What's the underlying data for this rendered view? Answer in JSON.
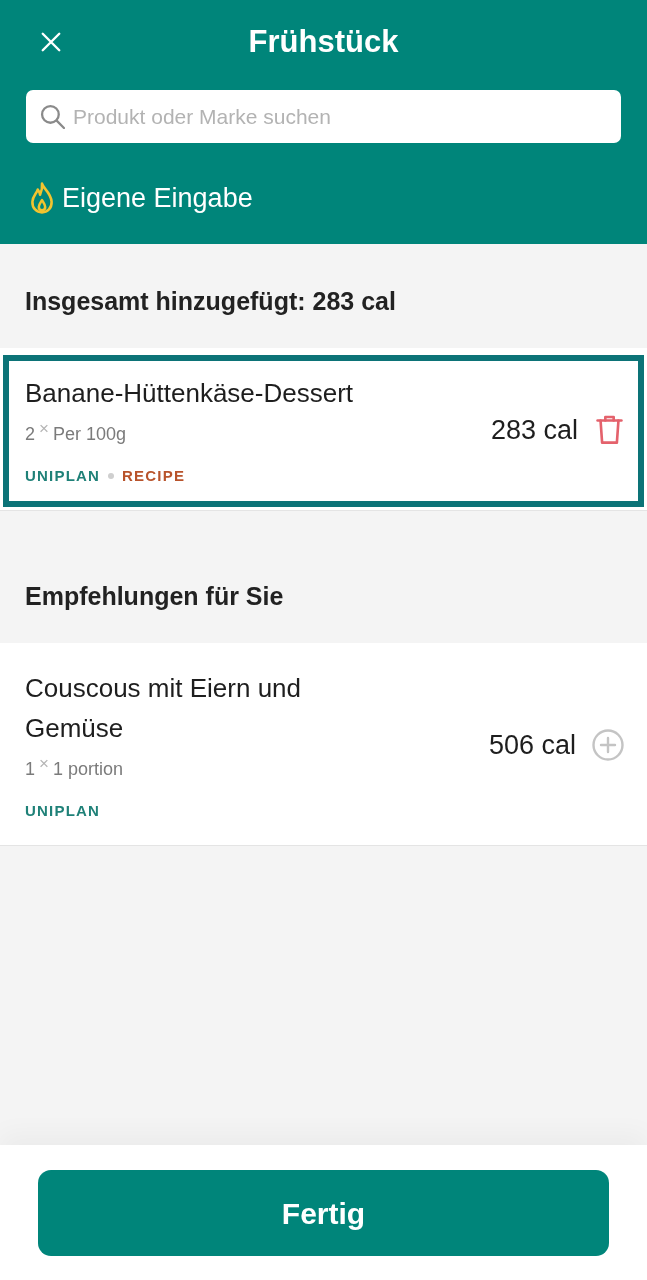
{
  "header": {
    "title": "Frühstück"
  },
  "search": {
    "placeholder": "Produkt oder Marke suchen"
  },
  "custom_entry": {
    "label": "Eigene Eingabe"
  },
  "added": {
    "heading": "Insgesamt hinzugefügt: 283 cal",
    "items": [
      {
        "name": "Banane-Hüttenkäse-Dessert",
        "quantity": "2",
        "times": "×",
        "unit": "Per 100g",
        "tags": [
          {
            "label": "UNIPLAN",
            "color": "#1f8178"
          },
          {
            "label": "RECIPE",
            "color": "#b8532b"
          }
        ],
        "calories": "283 cal",
        "kind": "delete",
        "selected": true
      }
    ]
  },
  "recommendations": {
    "heading": "Empfehlungen für Sie",
    "items": [
      {
        "name": "Couscous mit Eiern und Gemüse",
        "quantity": "1",
        "times": "×",
        "unit": "1 portion",
        "tags": [
          {
            "label": "UNIPLAN",
            "color": "#1f8178"
          }
        ],
        "calories": "506 cal",
        "kind": "add",
        "selected": false
      }
    ]
  },
  "done_button": {
    "label": "Fertig"
  }
}
